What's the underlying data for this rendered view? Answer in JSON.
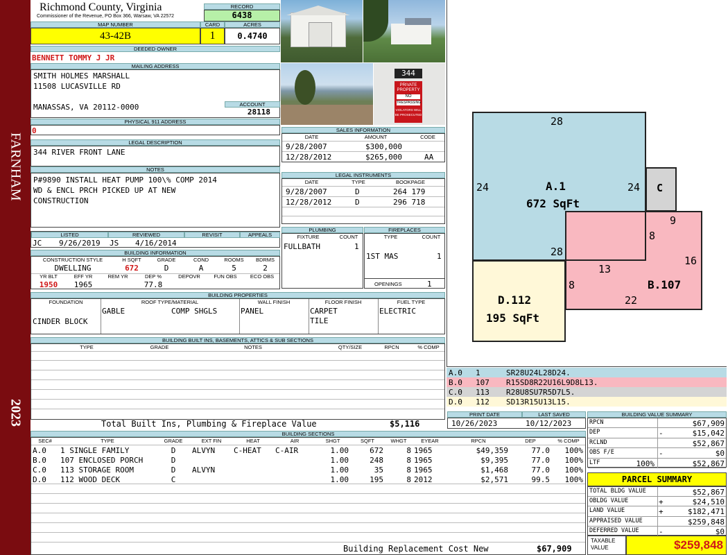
{
  "side": {
    "district": "FARNHAM",
    "year": "2023"
  },
  "header": {
    "county": "Richmond County, Virginia",
    "commissioner": "Commissioner of the Revenue, PO Box 366, Warsaw, VA 22572",
    "record_label": "RECORD",
    "record": "6438"
  },
  "ids": {
    "map_label": "MAP NUMBER",
    "map": "43-42B",
    "card_label": "CARD",
    "card": "1",
    "acres_label": "ACRES",
    "acres": "0.4740"
  },
  "owner": {
    "label": "DEEDED OWNER",
    "name": "BENNETT TOMMY J JR"
  },
  "mailing": {
    "label": "MAILING ADDRESS",
    "line1": "SMITH HOLMES MARSHALL",
    "line2": "11508 LUCASVILLE RD",
    "line3": "MANASSAS, VA 20112-0000",
    "account_label": "ACCOUNT",
    "account": "28118"
  },
  "physical": {
    "label": "PHYSICAL 911 ADDRESS",
    "value": "0"
  },
  "legal": {
    "label": "LEGAL DESCRIPTION",
    "value": "344 RIVER FRONT LANE"
  },
  "notes": {
    "label": "NOTES",
    "line1": "P#9890 INSTALL HEAT PUMP 100\\% COMP 2014",
    "line2": "WD & ENCL PRCH PICKED UP AT NEW",
    "line3": "CONSTRUCTION"
  },
  "review": {
    "listed_label": "LISTED",
    "reviewed_label": "REVIEWED",
    "revisit_label": "REVISIT",
    "appeals_label": "APPEALS",
    "listed_by": "JC",
    "listed_date": "9/26/2019",
    "reviewed_by": "JS",
    "reviewed_date": "4/16/2014"
  },
  "bldg_info": {
    "label": "BUILDING INFORMATION",
    "h": [
      "CONSTRUCTION STYLE",
      "H SQFT",
      "GRADE",
      "COND",
      "ROOMS",
      "BDRMS"
    ],
    "v": [
      "DWELLING",
      "672",
      "D",
      "A",
      "5",
      "2"
    ],
    "h2": [
      "YR BLT",
      "EFF YR",
      "REM YR",
      "DEP %",
      "DEPOVR",
      "FUN OBS",
      "ECO OBS"
    ],
    "v2": [
      "1950",
      "1965",
      "",
      "77.8",
      "",
      "",
      ""
    ]
  },
  "sales": {
    "label": "SALES INFORMATION",
    "h": [
      "DATE",
      "AMOUNT",
      "CODE"
    ],
    "rows": [
      [
        "9/28/2007",
        "$300,000",
        ""
      ],
      [
        "12/28/2012",
        "$265,000",
        "AA"
      ]
    ]
  },
  "instruments": {
    "label": "LEGAL INSTRUMENTS",
    "h": [
      "DATE",
      "TYPE",
      "BOOKPAGE"
    ],
    "rows": [
      [
        "9/28/2007",
        "D",
        "264 179"
      ],
      [
        "12/28/2012",
        "D",
        "296 718"
      ]
    ]
  },
  "plumbing": {
    "label": "PLUMBING",
    "h": [
      "FIXTURE",
      "COUNT"
    ],
    "fixture": "FULLBATH",
    "count": "1"
  },
  "fireplaces": {
    "label": "FIREPLACES",
    "h": [
      "TYPE",
      "COUNT"
    ],
    "type": "1ST MAS",
    "count": "1",
    "openings_label": "OPENINGS",
    "openings": "1"
  },
  "photo_sign": {
    "number": "344",
    "l1": "PRIVATE",
    "l2": "PROPERTY",
    "l3": "NO",
    "l4": "TRESPASSING",
    "l5": "VIOLATORS WILL",
    "l6": "BE PROSECUTED"
  },
  "props": {
    "label": "BUILDING PROPERTIES",
    "h": [
      "FOUNDATION",
      "ROOF TYPE/MATERIAL",
      "WALL FINISH",
      "FLOOR FINISH",
      "FUEL TYPE"
    ],
    "foundation": "CINDER BLOCK",
    "roof_type": "GABLE",
    "roof_mat": "COMP SHGLS",
    "wall": "PANEL",
    "floor1": "CARPET",
    "floor2": "TILE",
    "fuel": "ELECTRIC"
  },
  "builtins": {
    "label": "BUILDING BUILT INS, BASEMENTS, ATTICS & SUB SECTIONS",
    "h": [
      "TYPE",
      "GRADE",
      "NOTES",
      "QTY/SIZE",
      "RPCN",
      "% COMP"
    ],
    "total_label": "Total Built Ins, Plumbing & Fireplace Value",
    "total": "$5,116"
  },
  "sketch": {
    "a_label": "A.1",
    "a_area": "672 SqFt",
    "a_top": "28",
    "a_bottom": "28",
    "a_left": "24",
    "a_right": "24",
    "c_label": "C",
    "b_label": "B.107",
    "b_9": "9",
    "b_8": "8",
    "b_16": "16",
    "b_13": "13",
    "b_8b": "8",
    "b_22": "22",
    "d_label": "D.112",
    "d_area": "195 SqFt"
  },
  "vectors": [
    [
      "A.0",
      "1",
      "SR28U24L28D24."
    ],
    [
      "B.0",
      "107",
      "R15SD8R22U16L9D8L13."
    ],
    [
      "C.0",
      "113",
      "R28U8SU7R5D7L5."
    ],
    [
      "D.0",
      "112",
      "SD13R15U13L15."
    ]
  ],
  "vector_colors": [
    "#b8dbe5",
    "#f9b8c0",
    "#d4d4d4",
    "#fff8d8"
  ],
  "dates": {
    "print_label": "PRINT DATE",
    "print": "10/26/2023",
    "saved_label": "LAST SAVED",
    "saved": "10/12/2023"
  },
  "sections": {
    "label": "BUILDING SECTIONS",
    "h": [
      "SEC#",
      "TYPE",
      "GRADE",
      "EXT FIN",
      "HEAT",
      "AIR",
      "SHGT",
      "SQFT",
      "WHGT",
      "EYEAR",
      "RPCN",
      "DEP",
      "% COMP"
    ],
    "rows": [
      [
        "A.0",
        "1 SINGLE FAMILY",
        "D",
        "ALVYN",
        "C-HEAT",
        "C-AIR",
        "1.00",
        "672",
        "8",
        "1965",
        "$49,359",
        "77.0",
        "100%"
      ],
      [
        "B.0",
        "107 ENCLOSED PORCH",
        "D",
        "",
        "",
        "",
        "1.00",
        "248",
        "8",
        "1965",
        "$9,395",
        "77.0",
        "100%"
      ],
      [
        "C.0",
        "113 STORAGE ROOM",
        "D",
        "ALVYN",
        "",
        "",
        "1.00",
        "35",
        "8",
        "1965",
        "$1,468",
        "77.0",
        "100%"
      ],
      [
        "D.0",
        "112 WOOD DECK",
        "C",
        "",
        "",
        "",
        "1.00",
        "195",
        "8",
        "2012",
        "$2,571",
        "99.5",
        "100%"
      ]
    ],
    "total_label": "Building Replacement Cost New",
    "total": "$67,909"
  },
  "bvs": {
    "label": "BUILDING VALUE SUMMARY",
    "rows": [
      [
        "RPCN",
        "",
        "$67,909"
      ],
      [
        "DEP",
        "-",
        "$15,042"
      ],
      [
        "RCLND",
        "",
        "$52,867"
      ],
      [
        "OBS F/E",
        "-",
        "$0"
      ],
      [
        "LTF",
        "100%",
        "$52,867"
      ]
    ]
  },
  "parcel": {
    "label": "PARCEL SUMMARY",
    "rows": [
      [
        "TOTAL BLDG VALUE",
        "",
        "$52,867"
      ],
      [
        "OBLDG VALUE",
        "+",
        "$24,510"
      ],
      [
        "LAND VALUE",
        "+",
        "$182,471"
      ],
      [
        "APPRAISED VALUE",
        "",
        "$259,848"
      ],
      [
        "DEFERRED VALUE",
        "-",
        "$0"
      ]
    ],
    "taxable_l1": "TAXABLE",
    "taxable_l2": "VALUE",
    "taxable": "$259,848"
  }
}
